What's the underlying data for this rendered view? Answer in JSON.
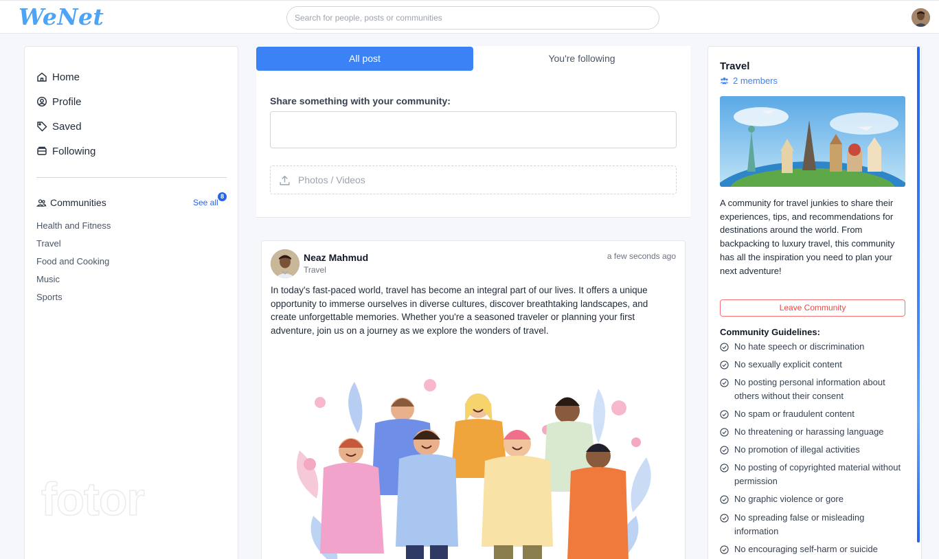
{
  "header": {
    "logo": "WeNet",
    "search_placeholder": "Search for people, posts or communities"
  },
  "sidebar": {
    "nav": [
      {
        "label": "Home",
        "icon": "home-icon"
      },
      {
        "label": "Profile",
        "icon": "user-circle-icon"
      },
      {
        "label": "Saved",
        "icon": "tag-icon"
      },
      {
        "label": "Following",
        "icon": "inbox-icon"
      }
    ],
    "communities_label": "Communities",
    "see_all": "See all",
    "badge_count": "8",
    "communities": [
      "Health and Fitness",
      "Travel",
      "Food and Cooking",
      "Music",
      "Sports"
    ],
    "watermark": "fotor"
  },
  "feed": {
    "tabs": [
      "All post",
      "You're following"
    ],
    "active_tab": "All post",
    "share_label": "Share something with your community:",
    "share_value": "",
    "upload_label": "Photos / Videos"
  },
  "post": {
    "author": "Neaz Mahmud",
    "community": "Travel",
    "time": "a few seconds ago",
    "text": "In today's fast-paced world, travel has become an integral part of our lives. It offers a unique opportunity to immerse ourselves in diverse cultures, discover breathtaking landscapes, and create unforgettable memories. Whether you're a seasoned traveler or planning your first adventure, join us on a journey as we explore the wonders of travel."
  },
  "community_panel": {
    "title": "Travel",
    "members": "2 members",
    "description": "A community for travel junkies to share their experiences, tips, and recommendations for destinations around the world. From backpacking to luxury travel, this community has all the inspiration you need to plan your next adventure!",
    "leave_button": "Leave Community",
    "guidelines_title": "Community Guidelines:",
    "guidelines": [
      "No hate speech or discrimination",
      "No sexually explicit content",
      "No posting personal information about others without their consent",
      "No spam or fraudulent content",
      "No threatening or harassing language",
      "No promotion of illegal activities",
      "No posting of copyrighted material without permission",
      "No graphic violence or gore",
      "No spreading false or misleading information",
      "No encouraging self-harm or suicide"
    ]
  },
  "colors": {
    "accent": "#3b82f6",
    "logo": "#4da3f5",
    "danger": "#ef4444"
  }
}
